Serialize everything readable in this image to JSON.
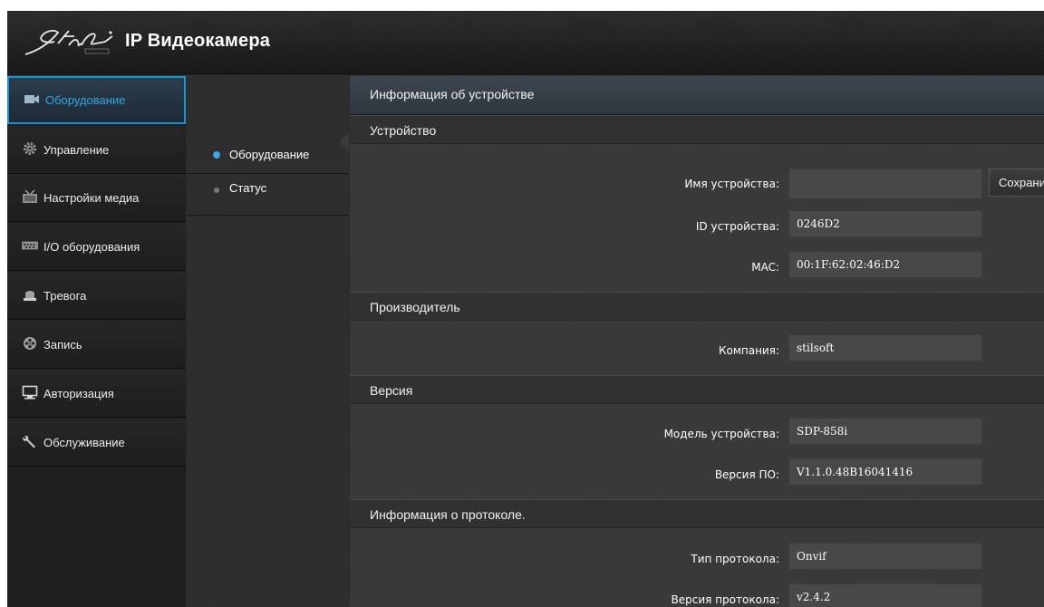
{
  "app": {
    "title": "IP Видеокамера",
    "logo_icon": "stilsoft-logo-icon"
  },
  "colors": {
    "accent": "#1594d1",
    "active_text": "#2fa6e0",
    "background": "#2b2b2b"
  },
  "sidebar": {
    "items": [
      {
        "label": "Оборудование",
        "icon": "camera-icon",
        "active": true
      },
      {
        "label": "Управление",
        "icon": "gear-icon",
        "active": false
      },
      {
        "label": "Настройки медиа",
        "icon": "media-icon",
        "active": false
      },
      {
        "label": "I/O оборудования",
        "icon": "io-port-icon",
        "active": false
      },
      {
        "label": "Тревога",
        "icon": "alarm-icon",
        "active": false
      },
      {
        "label": "Запись",
        "icon": "film-reel-icon",
        "active": false
      },
      {
        "label": "Авторизация",
        "icon": "monitor-icon",
        "active": false
      },
      {
        "label": "Обслуживание",
        "icon": "wrench-icon",
        "active": false
      }
    ]
  },
  "subnav": {
    "items": [
      {
        "label": "Оборудование",
        "active": true
      },
      {
        "label": "Статус",
        "active": false
      }
    ]
  },
  "main": {
    "title": "Информация об устройстве",
    "save_label": "Сохранить",
    "sections": {
      "device": {
        "title": "Устройство",
        "name_label": "Имя устройства:",
        "name_value": "",
        "id_label": "ID устройства:",
        "id_value": "0246D2",
        "mac_label": "MAC:",
        "mac_value": "00:1F:62:02:46:D2"
      },
      "manufacturer": {
        "title": "Производитель",
        "company_label": "Компания:",
        "company_value": "stilsoft"
      },
      "version": {
        "title": "Версия",
        "model_label": "Модель устройства:",
        "model_value": "SDP-858i",
        "fw_label": "Версия ПО:",
        "fw_value": "V1.1.0.48B16041416"
      },
      "protocol": {
        "title": "Информация о протоколе.",
        "type_label": "Тип протокола:",
        "type_value": "Onvif",
        "ver_label": "Версия протокола:",
        "ver_value": "v2.4.2"
      }
    }
  }
}
